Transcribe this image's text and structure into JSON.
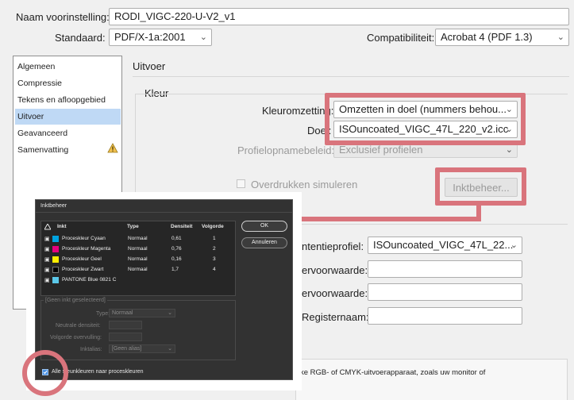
{
  "header": {
    "preset_label": "Naam voorinstelling:",
    "preset_value": "RODI_VIGC-220-U-V2_v1",
    "standard_label": "Standaard:",
    "standard_value": "PDF/X-1a:2001",
    "compat_label": "Compatibiliteit:",
    "compat_value": "Acrobat 4 (PDF 1.3)"
  },
  "sidebar": {
    "items": [
      {
        "label": "Algemeen"
      },
      {
        "label": "Compressie"
      },
      {
        "label": "Tekens en afloopgebied"
      },
      {
        "label": "Uitvoer"
      },
      {
        "label": "Geavanceerd"
      },
      {
        "label": "Samenvatting"
      }
    ],
    "active_index": 3
  },
  "main": {
    "section_title": "Uitvoer",
    "color_group_title": "Kleur",
    "conversion_label": "Kleuromzetting:",
    "conversion_value": "Omzetten in doel (nummers behou...",
    "target_label": "Doel:",
    "target_value": "ISOuncoated_VIGC_47L_220_v2.icc",
    "profile_policy_label": "Profielopnamebeleid:",
    "profile_policy_value": "Exclusief profielen",
    "overprint_label": "Overdrukken simuleren",
    "ink_manager_button": "Inktbeheer...",
    "intent_label": "ntentieprofiel:",
    "intent_value": "ISOuncoated_VIGC_47L_22...",
    "condition_label": "ervoorwaarde:",
    "condition_value": "",
    "condition_id_label": "ervoorwaarde:",
    "condition_id_value": "",
    "registry_label": "Registernaam:",
    "registry_value": "",
    "description_fragment": "ke RGB- of CMYK-uitvoerapparaat, zoals uw monitor of"
  },
  "ink_dialog": {
    "title": "Inktbeheer",
    "columns": [
      "Inkt",
      "Type",
      "Densiteit",
      "Volgorde"
    ],
    "inks": [
      {
        "name": "Proceskleur Cyaan",
        "type": "Normaal",
        "density": "0,61",
        "order": "1",
        "color": "#00a3e0"
      },
      {
        "name": "Proceskleur Magenta",
        "type": "Normaal",
        "density": "0,76",
        "order": "2",
        "color": "#e6007e"
      },
      {
        "name": "Proceskleur Geel",
        "type": "Normaal",
        "density": "0,16",
        "order": "3",
        "color": "#ffed00"
      },
      {
        "name": "Proceskleur Zwart",
        "type": "Normaal",
        "density": "1,7",
        "order": "4",
        "color": "#000000"
      },
      {
        "name": "PANTONE Blue 0821 C",
        "type": "",
        "density": "",
        "order": "",
        "color": "#5bc8e8"
      }
    ],
    "ok_label": "OK",
    "cancel_label": "Annuleren",
    "no_ink_selected": "[Geen inkt geselecteerd]",
    "type_label": "Type:",
    "type_value": "Normaal",
    "neutral_density_label": "Neutrale densiteit:",
    "trap_sequence_label": "Volgorde overvulling:",
    "ink_alias_label": "Inktalias:",
    "ink_alias_value": "[Geen alias]",
    "all_spots_label": "Alle steunkleuren naar proceskleuren"
  },
  "highlight_color": "#d9747c",
  "selection_color": "#bfd9f5"
}
